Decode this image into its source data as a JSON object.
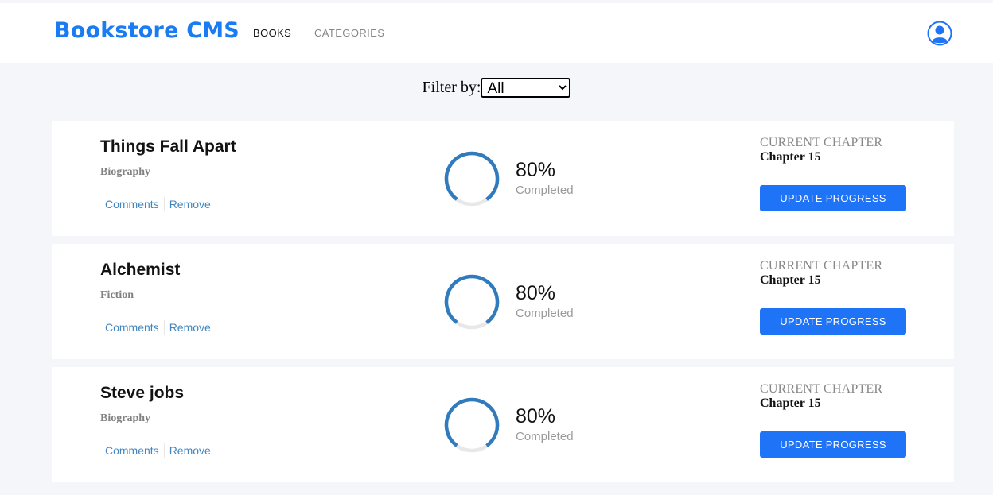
{
  "header": {
    "logo": "Bookstore CMS",
    "nav": [
      "BOOKS",
      "CATEGORIES"
    ],
    "profile_icon": "user-icon",
    "brand_color": "#1a7cf2"
  },
  "filter": {
    "label": "Filter by:",
    "selected": "All"
  },
  "books": [
    {
      "title": "Things Fall Apart",
      "category": "Biography",
      "actions": [
        "Comments",
        "Remove"
      ],
      "progress_percent": 80,
      "percent_label": "80%",
      "status": "Completed",
      "chapter_label": "CURRENT CHAPTER",
      "chapter": "Chapter 15",
      "button": "UPDATE PROGRESS"
    },
    {
      "title": "Alchemist",
      "category": "Fiction",
      "actions": [
        "Comments",
        "Remove"
      ],
      "progress_percent": 80,
      "percent_label": "80%",
      "status": "Completed",
      "chapter_label": "CURRENT CHAPTER",
      "chapter": "Chapter 15",
      "button": "UPDATE PROGRESS"
    },
    {
      "title": "Steve jobs",
      "category": "Biography",
      "actions": [
        "Comments",
        "Remove"
      ],
      "progress_percent": 80,
      "percent_label": "80%",
      "status": "Completed",
      "chapter_label": "CURRENT CHAPTER",
      "chapter": "Chapter 15",
      "button": "UPDATE PROGRESS"
    }
  ],
  "colors": {
    "accent": "#1f73f7",
    "progress": "#307bbe",
    "progress_track": "#e8e8e8",
    "link": "#4386bf"
  }
}
